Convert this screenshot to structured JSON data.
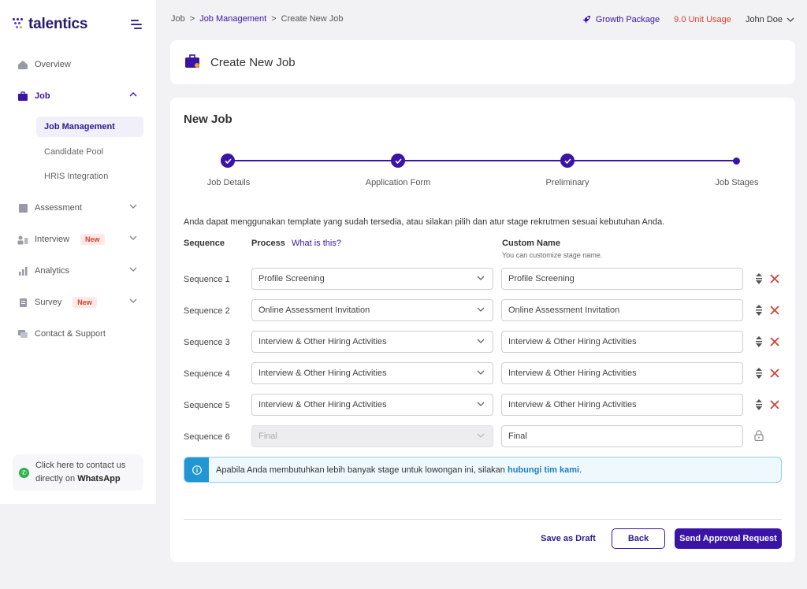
{
  "app": {
    "name": "talentics"
  },
  "colors": {
    "brand": "#3a14a6",
    "danger": "#d64032",
    "info": "#2196d3",
    "whatsapp": "#2bb34a"
  },
  "sidebar": {
    "items": [
      {
        "label": "Overview",
        "icon": "home-icon"
      },
      {
        "label": "Job",
        "icon": "briefcase-icon",
        "active": true,
        "expanded": true
      },
      {
        "label": "Assessment",
        "icon": "clipboard-icon"
      },
      {
        "label": "Interview",
        "icon": "people-icon",
        "badge": "New"
      },
      {
        "label": "Analytics",
        "icon": "bar-chart-icon"
      },
      {
        "label": "Survey",
        "icon": "survey-icon",
        "badge": "New"
      },
      {
        "label": "Contact & Support",
        "icon": "chat-icon"
      }
    ],
    "job_sub_items": [
      "Job Management",
      "Candidate Pool",
      "HRIS Integration"
    ],
    "whatsapp": {
      "line1": "Click here to contact us",
      "line2_prefix": "directly on ",
      "line2_bold": "WhatsApp"
    }
  },
  "topbar": {
    "breadcrumb": [
      "Job",
      "Job Management",
      "Create New Job"
    ],
    "package": "Growth Package",
    "usage": "9.0 Unit Usage",
    "user": "John Doe"
  },
  "header": {
    "title": "Create New Job"
  },
  "form": {
    "title": "New Job",
    "steps": [
      "Job Details",
      "Application Form",
      "Preliminary",
      "Job Stages"
    ],
    "description": "Anda dapat menggunakan template yang sudah tersedia, atau silakan pilih dan atur stage rekrutmen sesuai kebutuhan Anda.",
    "columns": {
      "sequence": "Sequence",
      "process": "Process",
      "what_is_this": "What is this?",
      "custom_name": "Custom Name",
      "custom_name_hint": "You can customize stage name."
    },
    "rows": [
      {
        "label": "Sequence 1",
        "process": "Profile Screening",
        "custom": "Profile Screening"
      },
      {
        "label": "Sequence 2",
        "process": "Online Assessment Invitation",
        "custom": "Online Assessment Invitation"
      },
      {
        "label": "Sequence 3",
        "process": "Interview & Other Hiring Activities",
        "custom": "Interview & Other Hiring Activities"
      },
      {
        "label": "Sequence 4",
        "process": "Interview & Other Hiring Activities",
        "custom": "Interview & Other Hiring Activities"
      },
      {
        "label": "Sequence 5",
        "process": "Interview & Other Hiring Activities",
        "custom": "Interview & Other Hiring Activities"
      },
      {
        "label": "Sequence 6",
        "process": "Final",
        "custom": "Final",
        "locked": true
      }
    ],
    "info": {
      "text": "Apabila Anda membutuhkan lebih banyak stage untuk lowongan ini, silakan ",
      "link": "hubungi tim kami",
      "suffix": "."
    },
    "buttons": {
      "draft": "Save as Draft",
      "back": "Back",
      "submit": "Send Approval Request"
    }
  }
}
